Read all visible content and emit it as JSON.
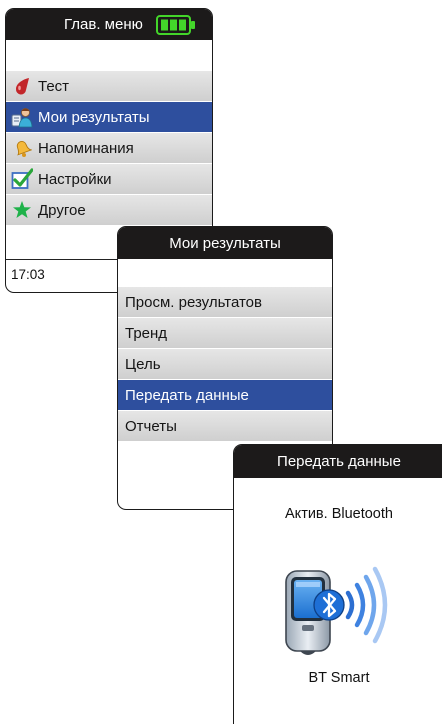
{
  "main_menu": {
    "title": "Глав. меню",
    "items": [
      {
        "label": "Тест",
        "icon": "blood-drop-icon"
      },
      {
        "label": "Мои результаты",
        "icon": "user-results-icon"
      },
      {
        "label": "Напоминания",
        "icon": "bell-icon"
      },
      {
        "label": "Настройки",
        "icon": "checkmark-icon"
      },
      {
        "label": "Другое",
        "icon": "star-icon"
      }
    ],
    "selected_index": 1,
    "time": "17:03"
  },
  "results_menu": {
    "title": "Мои результаты",
    "items": [
      {
        "label": "Просм. результатов"
      },
      {
        "label": "Тренд"
      },
      {
        "label": "Цель"
      },
      {
        "label": "Передать данные"
      },
      {
        "label": "Отчеты"
      }
    ],
    "selected_index": 3
  },
  "transfer_screen": {
    "title": "Передать данные",
    "status": "Актив. Bluetooth",
    "footer": "BT Smart"
  },
  "colors": {
    "selection": "#2e4f9e",
    "titlebar": "#1c1a1a",
    "battery": "#43d62a",
    "bluetooth": "#1e6fd6"
  }
}
